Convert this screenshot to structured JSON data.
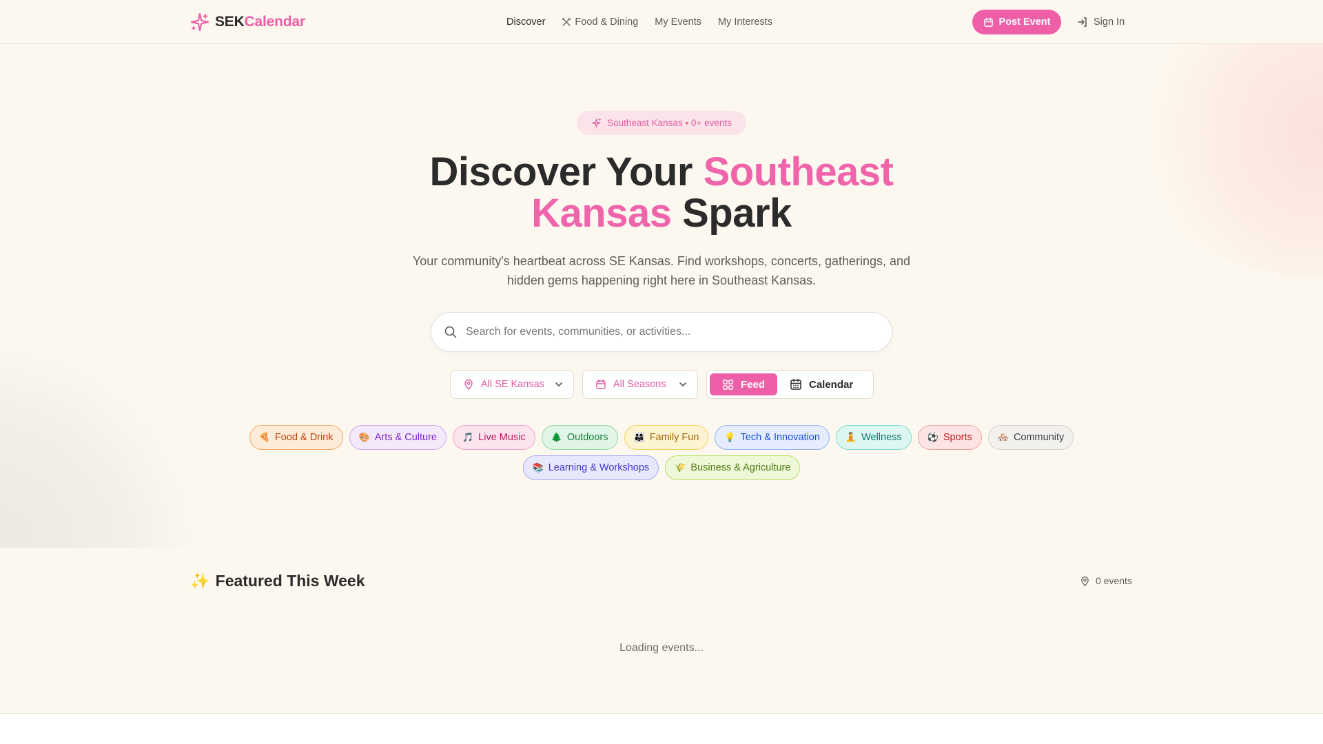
{
  "brand": {
    "name_part1": "SEK",
    "name_part2": "Calendar",
    "accent": "#ef5fa8"
  },
  "nav": {
    "links": [
      {
        "label": "Discover"
      },
      {
        "label": "Food & Dining",
        "icon": "utensils-icon"
      },
      {
        "label": "My Events"
      },
      {
        "label": "My Interests"
      }
    ],
    "post_event": "Post Event",
    "sign_in": "Sign In"
  },
  "hero": {
    "badge": "Southeast Kansas • 0+ events",
    "title_part1": "Discover Your ",
    "title_highlight": "Southeast Kansas",
    "title_part2": " Spark",
    "subtitle": "Your community's heartbeat across SE Kansas. Find workshops, concerts, gatherings, and hidden gems happening right here in Southeast Kansas."
  },
  "search": {
    "placeholder": "Search for events, communities, or activities...",
    "value": ""
  },
  "filters": {
    "location": "All SE Kansas",
    "season": "All Seasons",
    "view_feed": "Feed",
    "view_calendar": "Calendar",
    "active_view": "Feed"
  },
  "categories": [
    {
      "emoji": "🍕",
      "label": "Food & Drink",
      "color": "#c2410c",
      "bg": "#fdecd9",
      "border": "#f7a963"
    },
    {
      "emoji": "🎨",
      "label": "Arts & Culture",
      "color": "#7e22ce",
      "bg": "#f4e8fb",
      "border": "#d4a9f0"
    },
    {
      "emoji": "🎵",
      "label": "Live Music",
      "color": "#be185d",
      "bg": "#fce4ee",
      "border": "#f2a1c4"
    },
    {
      "emoji": "🌲",
      "label": "Outdoors",
      "color": "#15803d",
      "bg": "#e1f5e6",
      "border": "#8fdca6"
    },
    {
      "emoji": "👨‍👩‍👧",
      "label": "Family Fun",
      "color": "#a16207",
      "bg": "#fdf5d2",
      "border": "#f0d45c"
    },
    {
      "emoji": "💡",
      "label": "Tech & Innovation",
      "color": "#1d4ed8",
      "bg": "#e4ecfd",
      "border": "#94b4f4"
    },
    {
      "emoji": "🧘",
      "label": "Wellness",
      "color": "#0f766e",
      "bg": "#dcf6f1",
      "border": "#7fdccd"
    },
    {
      "emoji": "⚽",
      "label": "Sports",
      "color": "#b91c1c",
      "bg": "#fde4e4",
      "border": "#f4a3a3"
    },
    {
      "emoji": "🏘️",
      "label": "Community",
      "color": "#3f3f46",
      "bg": "#f3f1ee",
      "border": "#d6d2cc"
    },
    {
      "emoji": "📚",
      "label": "Learning & Workshops",
      "color": "#4338ca",
      "bg": "#e7e8fb",
      "border": "#a7abee"
    },
    {
      "emoji": "🌾",
      "label": "Business & Agriculture",
      "color": "#4d7c0f",
      "bg": "#eef8d8",
      "border": "#b5e06a"
    }
  ],
  "featured": {
    "emoji": "✨",
    "title": "Featured This Week",
    "count": "0 events",
    "loading": "Loading events..."
  }
}
